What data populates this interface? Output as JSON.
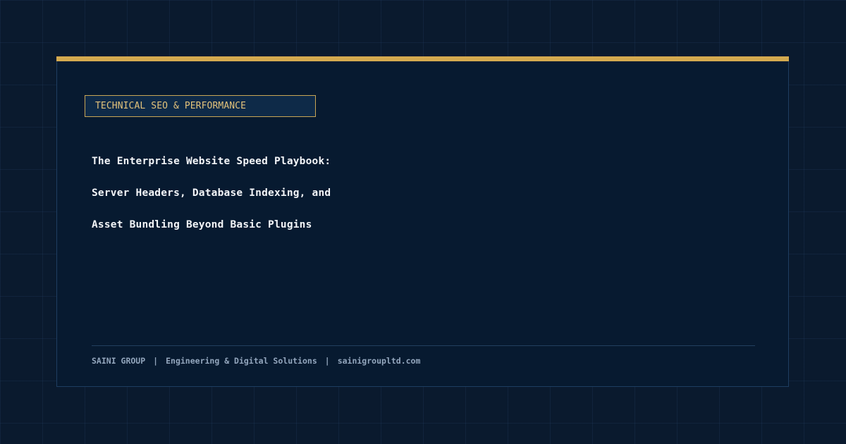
{
  "category_tag": "TECHNICAL SEO & PERFORMANCE",
  "title_lines": [
    "The Enterprise Website Speed Playbook:",
    "Server Headers, Database Indexing, and",
    "Asset Bundling Beyond Basic Plugins"
  ],
  "footer": {
    "brand": "SAINI GROUP",
    "separator": "|",
    "tagline": "Engineering & Digital Solutions",
    "website": "sainigroupltd.com"
  },
  "colors": {
    "background": "#0a1a2e",
    "card": "#071a30",
    "accent": "#d4aa4f",
    "title_text": "#f3f5f8",
    "footer_text": "#93a6bd"
  }
}
